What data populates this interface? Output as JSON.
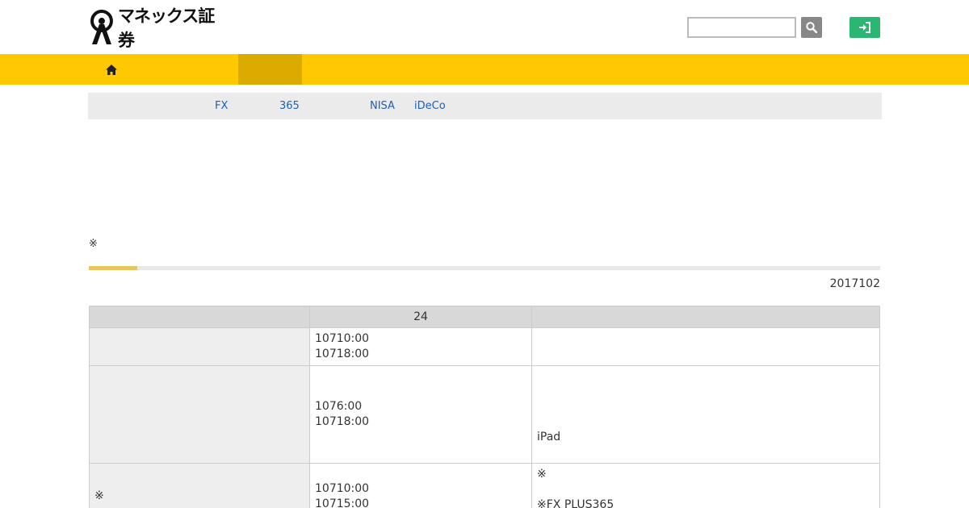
{
  "header": {
    "logo_text": "マネックス証券",
    "search": {
      "value": "",
      "placeholder": ""
    },
    "search_icon": "search-icon",
    "login_icon": "login-icon"
  },
  "nav": {
    "home_icon": "home-icon",
    "active_index": 1
  },
  "subnav": {
    "links": [
      "FX",
      "365",
      "NISA",
      "iDeCo"
    ]
  },
  "note": "※",
  "progress": {
    "fraction": 0.061
  },
  "date": "2017102",
  "table": {
    "headers": [
      "",
      "24",
      ""
    ],
    "rows": [
      {
        "label": "",
        "times": [
          "10710:00",
          "10718:00"
        ],
        "notes": []
      },
      {
        "label": "",
        "times": [
          "1076:00",
          "10718:00"
        ],
        "notes": [
          "iPad"
        ]
      },
      {
        "label": "※",
        "times": [
          "10710:00",
          "10715:00"
        ],
        "notes": [
          "※",
          "※FX PLUS365"
        ]
      }
    ]
  },
  "colors": {
    "nav_yellow": "#ffc800",
    "nav_active": "#dbab00",
    "login_green": "#2bb673",
    "link_blue": "#1e5fb4",
    "progress_fill": "#e8c45a"
  }
}
